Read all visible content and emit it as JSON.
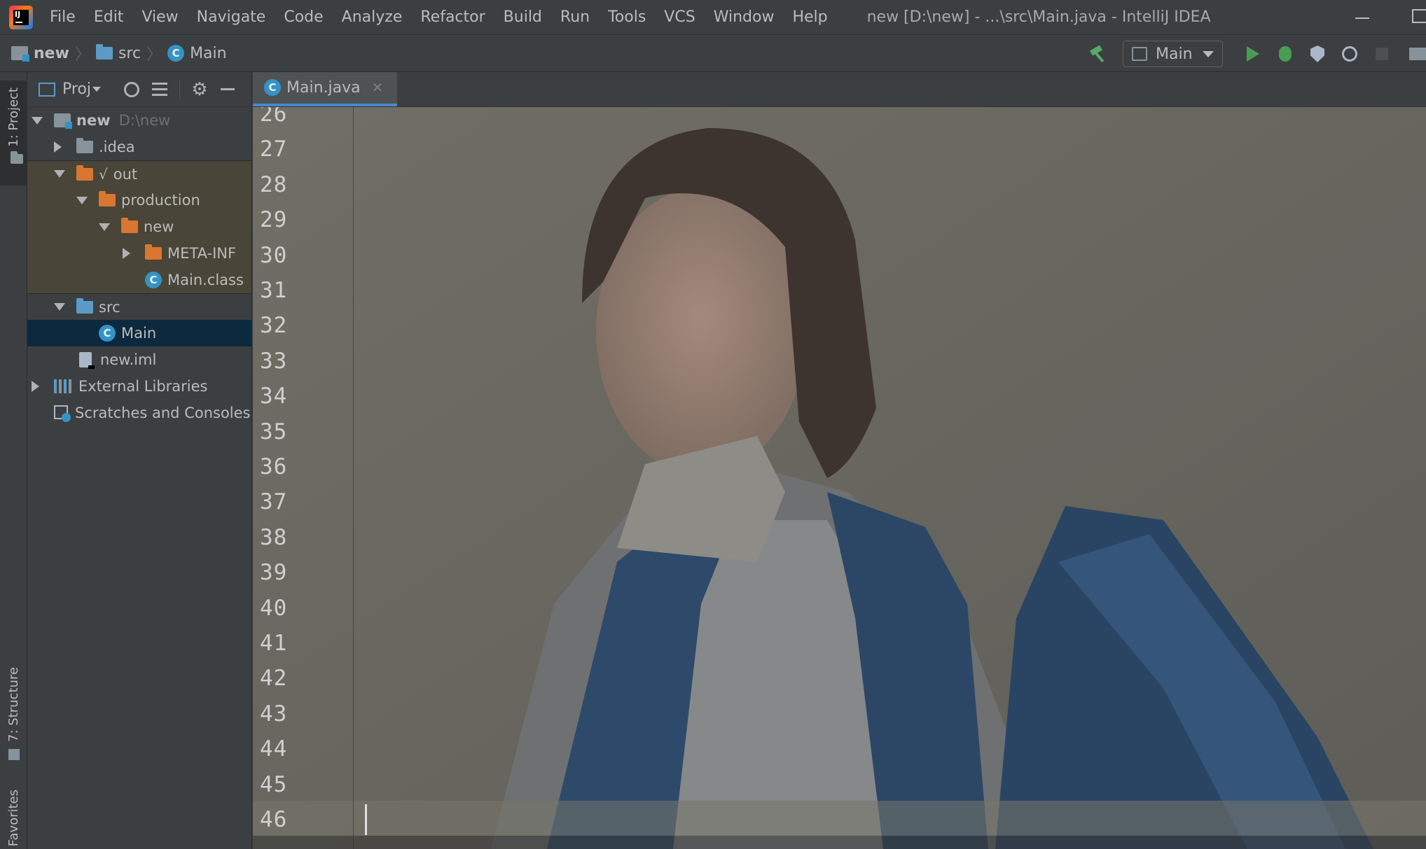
{
  "app": {
    "menu": [
      "File",
      "Edit",
      "View",
      "Navigate",
      "Code",
      "Analyze",
      "Refactor",
      "Build",
      "Run",
      "Tools",
      "VCS",
      "Window",
      "Help"
    ],
    "window_title": "new [D:\\new] - ...\\src\\Main.java - IntelliJ IDEA"
  },
  "breadcrumb": {
    "project": "new",
    "folder": "src",
    "file": "Main"
  },
  "toolbar": {
    "run_config": "Main"
  },
  "left_strip": {
    "project": "1: Project",
    "structure": "7: Structure",
    "favorites": "Favorites"
  },
  "project_panel": {
    "view_label": "Proj",
    "tree": {
      "root_name": "new",
      "root_path": "D:\\new",
      "idea": ".idea",
      "out": "out",
      "production": "production",
      "production_new": "new",
      "meta_inf": "META-INF",
      "main_class": "Main.class",
      "src": "src",
      "main": "Main",
      "iml": "new.iml",
      "external_libraries": "External Libraries",
      "scratches": "Scratches and Consoles"
    }
  },
  "editor": {
    "tab_label": "Main.java",
    "line_numbers": [
      "26",
      "27",
      "28",
      "29",
      "30",
      "31",
      "32",
      "33",
      "34",
      "35",
      "36",
      "37",
      "38",
      "39",
      "40",
      "41",
      "42",
      "43",
      "44",
      "45",
      "46"
    ],
    "current_line": "46"
  },
  "colors": {
    "accent": "#4a88c7",
    "class_icon": "#3592c4",
    "run_green": "#499c54"
  }
}
